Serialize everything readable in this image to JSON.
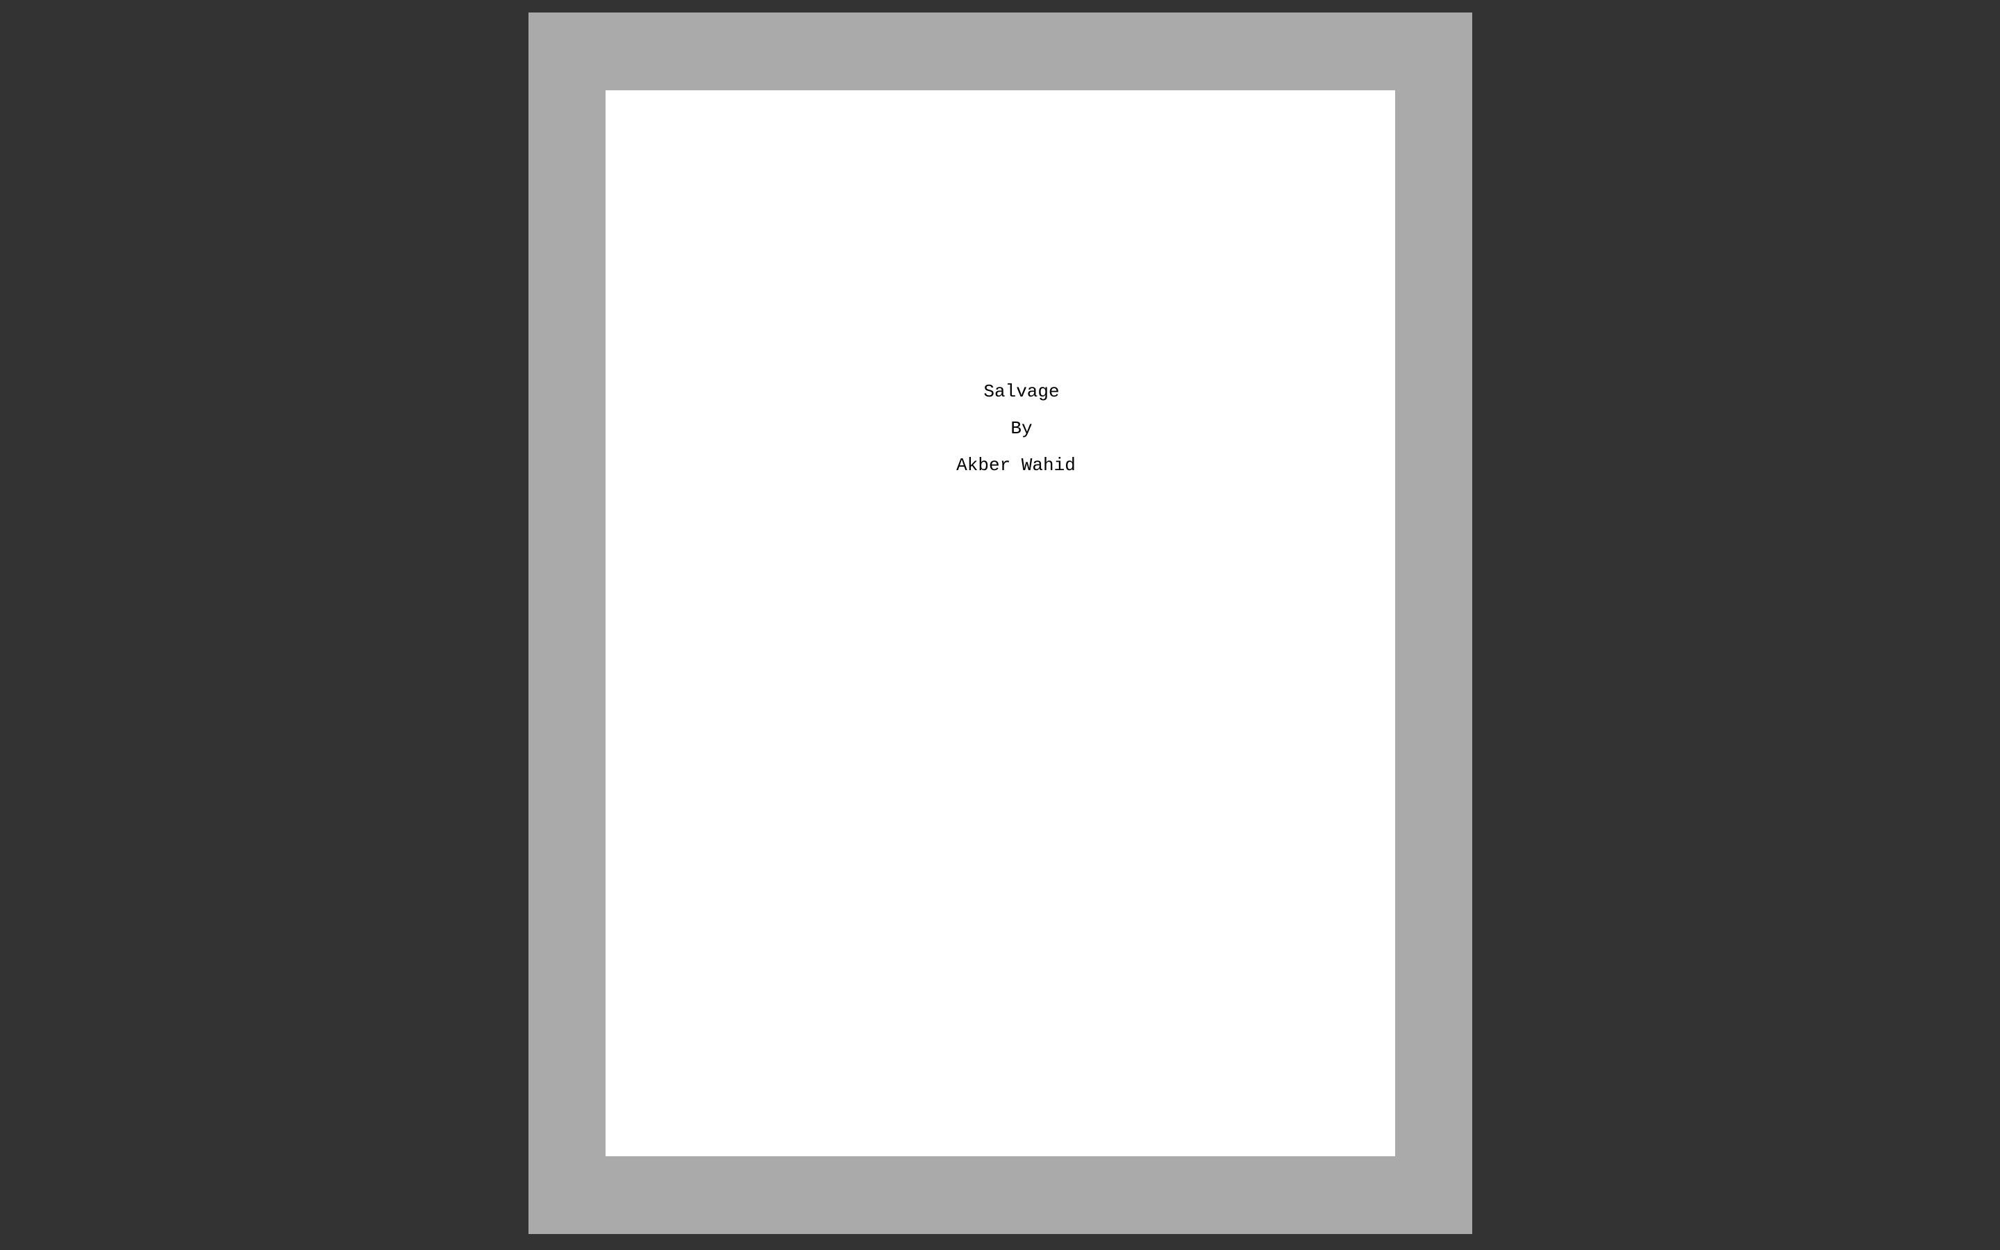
{
  "title_page": {
    "title": "Salvage",
    "by_line": "By",
    "author": "Akber Wahid"
  }
}
